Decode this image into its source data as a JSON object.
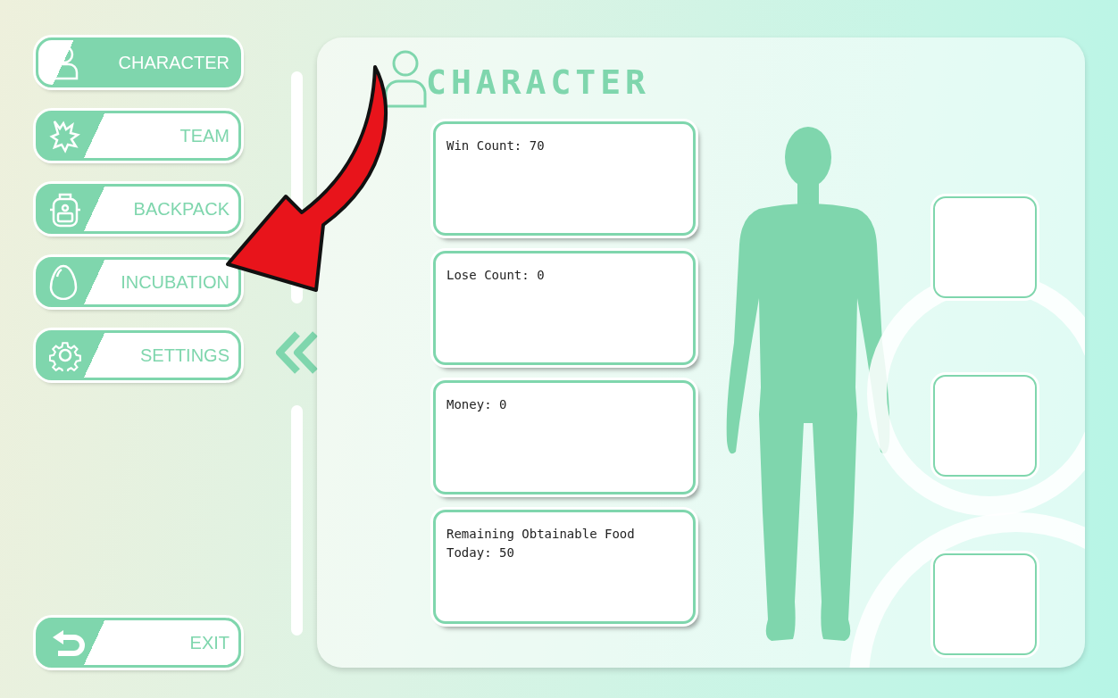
{
  "nav": [
    {
      "label": "CHARACTER",
      "selected": true
    },
    {
      "label": "TEAM",
      "selected": false
    },
    {
      "label": "BACKPACK",
      "selected": false
    },
    {
      "label": "INCUBATION",
      "selected": false
    },
    {
      "label": "SETTINGS",
      "selected": false
    }
  ],
  "exit": {
    "label": "EXIT"
  },
  "panel": {
    "title": "CHARACTER",
    "stats": [
      "Win Count: 70",
      "Lose Count: 0",
      "Money: 0",
      "Remaining Obtainable Food Today: 50"
    ]
  }
}
